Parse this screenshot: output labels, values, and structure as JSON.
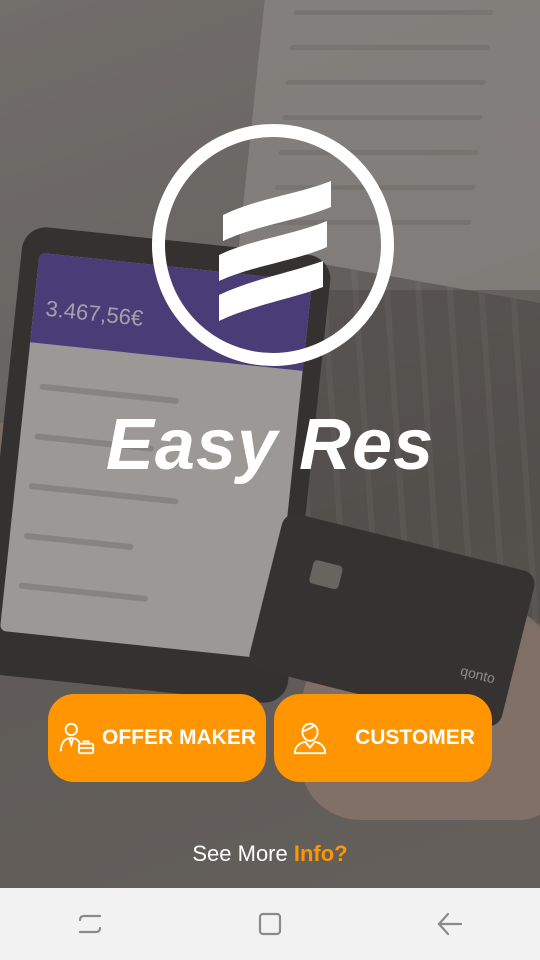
{
  "app": {
    "title": "Easy Res"
  },
  "background": {
    "phone_balance": "3.467,56€",
    "card_brand": "qonto"
  },
  "buttons": {
    "offer_maker": {
      "label": "OFFER MAKER",
      "icon": "businessman-briefcase-icon"
    },
    "customer": {
      "label": "CUSTOMER",
      "icon": "customer-person-icon"
    }
  },
  "info": {
    "prefix": "See More ",
    "link": "Info?"
  },
  "navbar": {
    "items": [
      {
        "name": "recent-apps",
        "icon": "recent-apps-icon"
      },
      {
        "name": "home",
        "icon": "home-icon"
      },
      {
        "name": "back",
        "icon": "back-arrow-icon"
      }
    ]
  },
  "colors": {
    "accent": "#ff9500",
    "text": "#ffffff",
    "navbar": "#f2f2f2"
  }
}
